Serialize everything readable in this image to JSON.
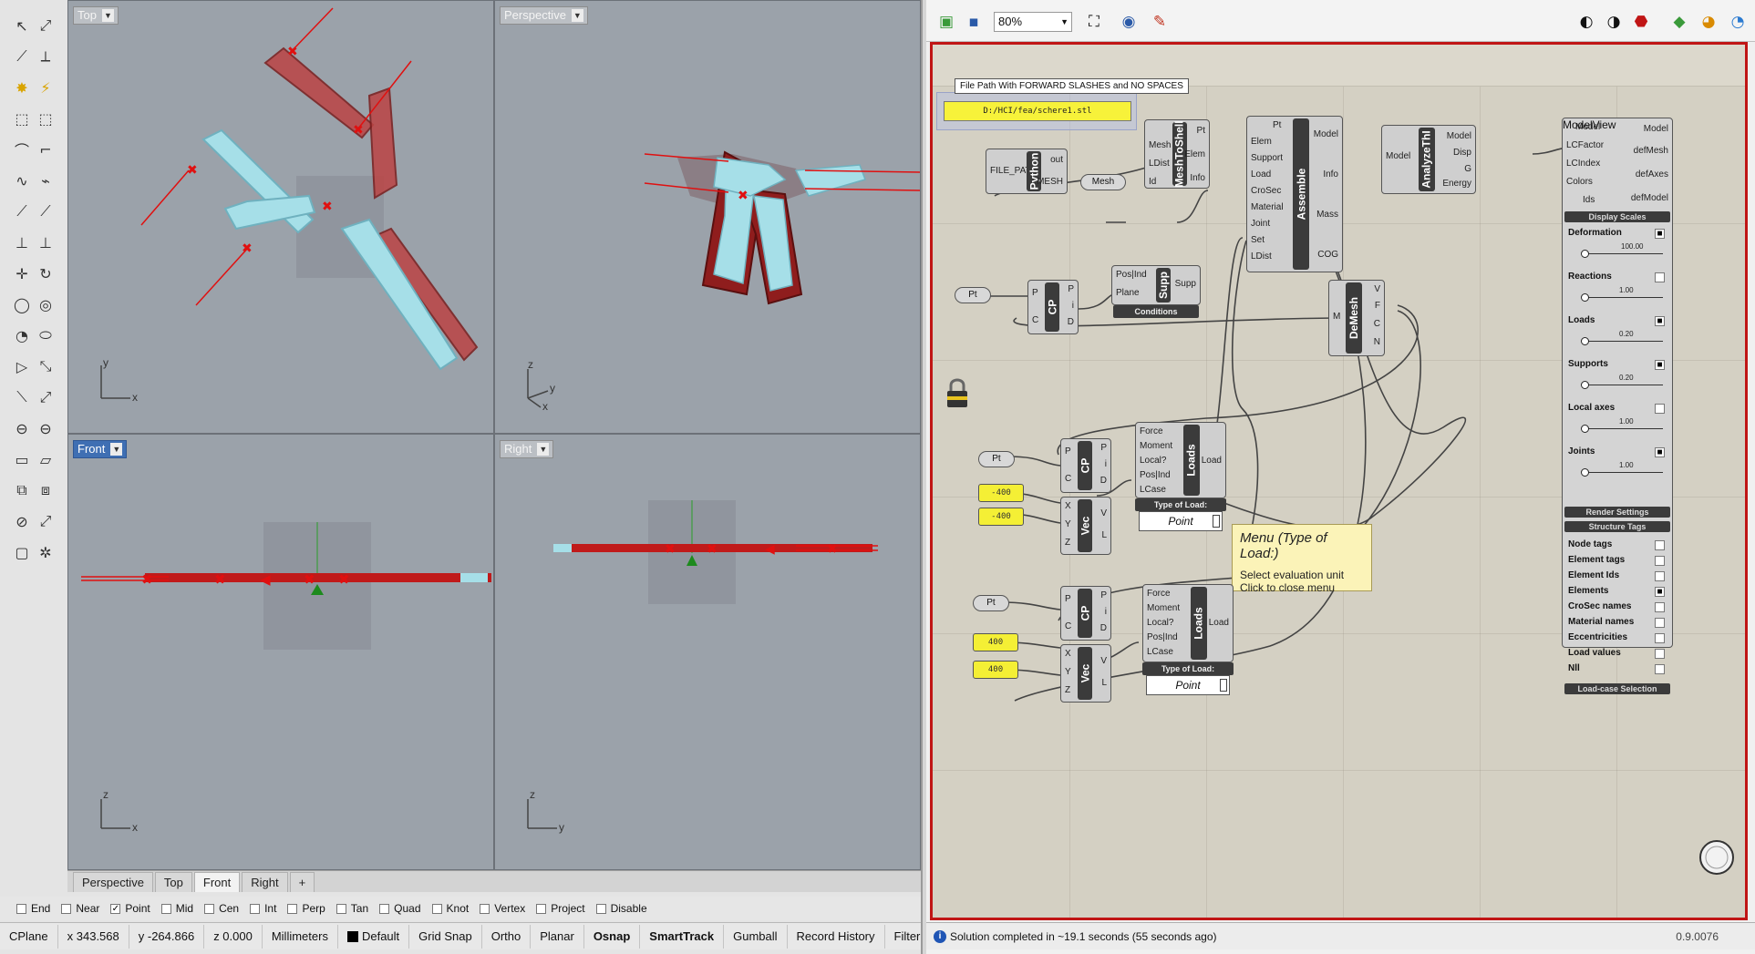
{
  "rhino": {
    "viewports": {
      "top": {
        "title": "Top",
        "axis_h": "x",
        "axis_v": "y"
      },
      "perspective": {
        "title": "Perspective",
        "axis_h": "x",
        "axis_v": "y",
        "axis_z": "z"
      },
      "front": {
        "title": "Front",
        "axis_h": "x",
        "axis_v": "z"
      },
      "right": {
        "title": "Right",
        "axis_h": "y",
        "axis_v": "z"
      }
    },
    "view_tabs": [
      "Perspective",
      "Top",
      "Front",
      "Right"
    ],
    "active_tab": "Front",
    "add_tab": "+",
    "osnaps": [
      {
        "label": "End",
        "checked": false
      },
      {
        "label": "Near",
        "checked": false
      },
      {
        "label": "Point",
        "checked": true
      },
      {
        "label": "Mid",
        "checked": false
      },
      {
        "label": "Cen",
        "checked": false
      },
      {
        "label": "Int",
        "checked": false
      },
      {
        "label": "Perp",
        "checked": false
      },
      {
        "label": "Tan",
        "checked": false
      },
      {
        "label": "Quad",
        "checked": false
      },
      {
        "label": "Knot",
        "checked": false
      },
      {
        "label": "Vertex",
        "checked": false
      },
      {
        "label": "Project",
        "checked": false
      },
      {
        "label": "Disable",
        "checked": false
      }
    ],
    "status": {
      "cplane": "CPlane",
      "x": "x 343.568",
      "y": "y -264.866",
      "z": "z 0.000",
      "units": "Millimeters",
      "layer": "Default",
      "grid_snap": "Grid Snap",
      "ortho": "Ortho",
      "planar": "Planar",
      "osnap": "Osnap",
      "smarttrack": "SmartTrack",
      "gumball": "Gumball",
      "record_history": "Record History",
      "filter": "Filter"
    }
  },
  "grasshopper": {
    "zoom": "80%",
    "file_path_note": "File Path With FORWARD SLASHES and NO SPACES",
    "file_path_value": "D:/HCI/fea/schere1.stl",
    "python": {
      "name": "Python",
      "inputs": [
        "FILE_PATH"
      ],
      "outputs": [
        "out",
        "MESH"
      ]
    },
    "mesh_param": "Mesh",
    "mesh_to_shell": {
      "name": "MeshToShell",
      "inputs": [
        "Mesh",
        "LDist",
        "Id"
      ],
      "outputs": [
        "Pt",
        "Elem",
        "Info"
      ]
    },
    "assemble": {
      "name": "Assemble",
      "inputs": [
        "Pt",
        "Elem",
        "Support",
        "Load",
        "CroSec",
        "Material",
        "Joint",
        "Set",
        "LDist"
      ],
      "outputs": [
        "Model",
        "Info",
        "Mass",
        "COG"
      ]
    },
    "analyze": {
      "name": "AnalyzeThI",
      "inputs": [
        "Model"
      ],
      "outputs": [
        "Model",
        "Disp",
        "G",
        "Energy"
      ]
    },
    "modelview": {
      "name": "ModelView",
      "inputs": [
        "Model",
        "LCFactor",
        "LCIndex",
        "Colors",
        "Ids"
      ],
      "outputs": [
        "Model",
        "defMesh",
        "defAxes",
        "defModel"
      ]
    },
    "pt_params": [
      "Pt",
      "Pt",
      "Pt"
    ],
    "cp": {
      "name": "CP",
      "inputs": [
        "P",
        "C"
      ],
      "outputs": [
        "P",
        "i",
        "D"
      ]
    },
    "supp": {
      "name": "Supp",
      "inputs": [
        "Pos|Ind",
        "Plane"
      ],
      "outputs": [
        "Supp"
      ],
      "sub": "Conditions"
    },
    "demesh": {
      "name": "DeMesh",
      "inputs": [
        "M"
      ],
      "outputs": [
        "V",
        "F",
        "C",
        "N"
      ]
    },
    "vec": {
      "name": "Vec",
      "inputs": [
        "X",
        "Y",
        "Z"
      ],
      "outputs": [
        "V",
        "L"
      ]
    },
    "loads": {
      "name": "Loads",
      "inputs": [
        "Force",
        "Moment",
        "Local?",
        "Pos|Ind",
        "LCase"
      ],
      "outputs": [
        "Load"
      ],
      "sub": "Type of Load:",
      "value": "Point"
    },
    "num_a1": "-400",
    "num_a2": "-400",
    "num_b1": "400",
    "num_b2": "400",
    "display_panel": {
      "header": "Display Scales",
      "rows": [
        {
          "label": "Deformation",
          "checked": true,
          "value": "100.00"
        },
        {
          "label": "Reactions",
          "checked": false,
          "value": "1.00"
        },
        {
          "label": "Loads",
          "checked": true,
          "value": "0.20"
        },
        {
          "label": "Supports",
          "checked": true,
          "value": "0.20"
        },
        {
          "label": "Local axes",
          "checked": false,
          "value": "1.00"
        },
        {
          "label": "Joints",
          "checked": true,
          "value": "1.00"
        }
      ],
      "render_settings": "Render Settings",
      "structure_tags": "Structure Tags",
      "tags": [
        {
          "label": "Node tags",
          "checked": false
        },
        {
          "label": "Element tags",
          "checked": false
        },
        {
          "label": "Element Ids",
          "checked": false
        },
        {
          "label": "Elements",
          "checked": true
        },
        {
          "label": "CroSec names",
          "checked": false
        },
        {
          "label": "Material names",
          "checked": false
        },
        {
          "label": "Eccentricities",
          "checked": false
        },
        {
          "label": "Load values",
          "checked": false
        },
        {
          "label": "Nll",
          "checked": false
        }
      ],
      "load_case": "Load-case Selection"
    },
    "tooltip": {
      "title": "Menu (Type of Load:)",
      "line1": "Select evaluation unit",
      "line2": "Click to close menu"
    },
    "status": "Solution completed in ~19.1 seconds (55 seconds ago)",
    "version": "0.9.0076"
  }
}
